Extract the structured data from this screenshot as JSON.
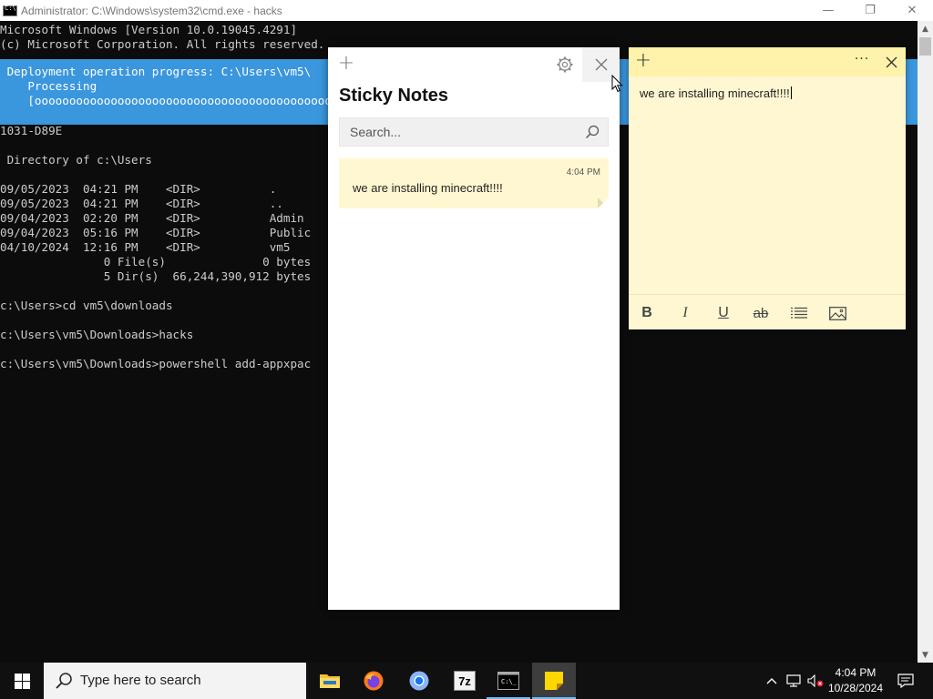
{
  "cmd": {
    "title": "Administrator: C:\\Windows\\system32\\cmd.exe - hacks",
    "controls": {
      "minimize": "—",
      "restore": "❐",
      "close": "✕"
    },
    "lines_top": [
      "Microsoft Windows [Version 10.0.19045.4291]",
      "(c) Microsoft Corporation. All rights reserved."
    ],
    "progress_lines": [
      " Deployment operation progress: C:\\Users\\vm5\\",
      "    Processing",
      "    [ooooooooooooooooooooooooooooooooooooooooooooo"
    ],
    "lines_bottom": [
      "1031-D89E",
      "",
      " Directory of c:\\Users",
      "",
      "09/05/2023  04:21 PM    <DIR>          .",
      "09/05/2023  04:21 PM    <DIR>          ..",
      "09/04/2023  02:20 PM    <DIR>          Admin",
      "09/04/2023  05:16 PM    <DIR>          Public",
      "04/10/2024  12:16 PM    <DIR>          vm5",
      "               0 File(s)              0 bytes",
      "               5 Dir(s)  66,244,390,912 bytes",
      "",
      "c:\\Users>cd vm5\\downloads",
      "",
      "c:\\Users\\vm5\\Downloads>hacks",
      "",
      "c:\\Users\\vm5\\Downloads>powershell add-appxpac"
    ]
  },
  "sticky_list": {
    "heading": "Sticky Notes",
    "search_placeholder": "Search...",
    "note": {
      "time": "4:04 PM",
      "text": "we are installing minecraft!!!!"
    }
  },
  "sticky_note": {
    "text": "we are installing minecraft!!!!",
    "toolbar": {
      "bold": "B",
      "italic": "I",
      "underline": "U",
      "strike": "ab"
    }
  },
  "taskbar": {
    "search_placeholder": "Type here to search",
    "apps": [
      "File Explorer",
      "Firefox",
      "Chromium",
      "7-Zip",
      "Command Prompt",
      "Sticky Notes"
    ],
    "clock_time": "4:04 PM",
    "clock_date": "10/28/2024"
  },
  "colors": {
    "console_bg": "#0c0c0c",
    "progress_bg": "#3a96dd",
    "note_yellow": "#fff7d1",
    "note_header": "#fff2ab"
  }
}
